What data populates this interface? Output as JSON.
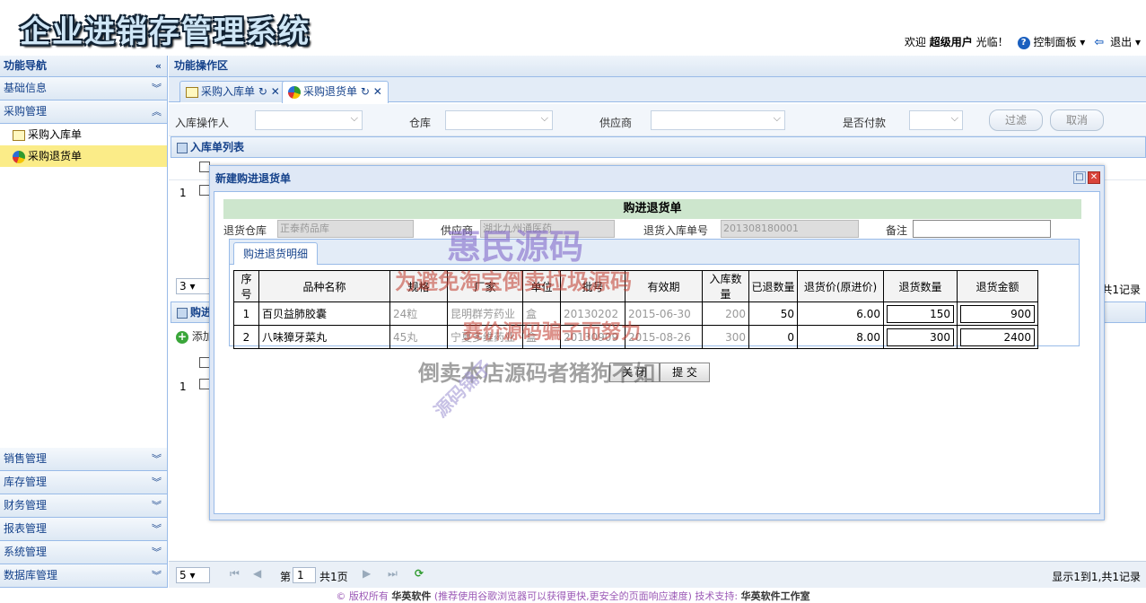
{
  "header": {
    "logo": "企业进销存管理系统",
    "welcome": "欢迎",
    "user": "超级用户",
    "welcome_suffix": "光临！",
    "control_panel": "控制面板",
    "logout": "退出"
  },
  "nav": {
    "title": "功能导航",
    "sections": [
      {
        "label": "基础信息"
      },
      {
        "label": "采购管理"
      }
    ],
    "purchase_items": [
      {
        "label": "采购入库单"
      },
      {
        "label": "采购退货单"
      }
    ],
    "bottom_sections": [
      {
        "label": "销售管理"
      },
      {
        "label": "库存管理"
      },
      {
        "label": "财务管理"
      },
      {
        "label": "报表管理"
      },
      {
        "label": "系统管理"
      },
      {
        "label": "数据库管理"
      }
    ]
  },
  "main": {
    "title": "功能操作区",
    "tabs": [
      {
        "label": "采购入库单"
      },
      {
        "label": "采购退货单"
      }
    ],
    "filter": {
      "operator_label": "入库操作人",
      "warehouse_label": "仓库",
      "supplier_label": "供应商",
      "paid_label": "是否付款",
      "filter_btn": "过滤",
      "cancel_btn": "取消"
    },
    "list_title": "入库单列表",
    "list_rownum": "1",
    "list_pagesize": "3",
    "list_count": "共1记录",
    "section2_title": "购进",
    "add_label": "添加",
    "row2num": "1",
    "pager": {
      "size": "5",
      "page_label": "第",
      "page": "1",
      "total_pages": "共1页",
      "info": "显示1到1,共1记录"
    }
  },
  "dialog": {
    "title": "新建购进退货单",
    "form_title": "购进退货单",
    "warehouse_label": "退货仓库",
    "warehouse_value": "正泰药品库",
    "supplier_label": "供应商",
    "supplier_value": "湖北九州通医药",
    "receipt_label": "退货入库单号",
    "receipt_value": "201308180001",
    "note_label": "备注",
    "note_value": "",
    "detail_tab": "购进退货明细",
    "columns": [
      "序号",
      "品种名称",
      "规格",
      "厂家",
      "单位",
      "批号",
      "有效期",
      "入库数量",
      "已退数量",
      "退货价(原进价)",
      "退货数量",
      "退货金额"
    ],
    "rows": [
      [
        "1",
        "百贝益肺胶囊",
        "24粒",
        "昆明群芳药业",
        "盒",
        "20130202",
        "2015-06-30",
        "200",
        "50",
        "6.00",
        "150",
        "900"
      ],
      [
        "2",
        "八味獐牙菜丸",
        "45丸",
        "宁夏多维药业",
        "盒",
        "20130909",
        "2015-08-26",
        "300",
        "0",
        "8.00",
        "300",
        "2400"
      ]
    ],
    "close_btn": "关 闭",
    "submit_btn": "提 交"
  },
  "watermarks": {
    "w1": "惠民源码",
    "w2": "为避免淘宝倒卖垃圾源码",
    "w3": "赛价源码骗子而努力",
    "w4": "倒卖本店源码者猪狗不如",
    "w5": "源码铺子"
  },
  "footer": {
    "copyright": "© 版权所有",
    "company": "华英软件",
    "tip": "(推荐使用谷歌浏览器可以获得更快,更安全的页面响应速度)",
    "support_label": "技术支持:",
    "support": "华英软件工作室"
  }
}
